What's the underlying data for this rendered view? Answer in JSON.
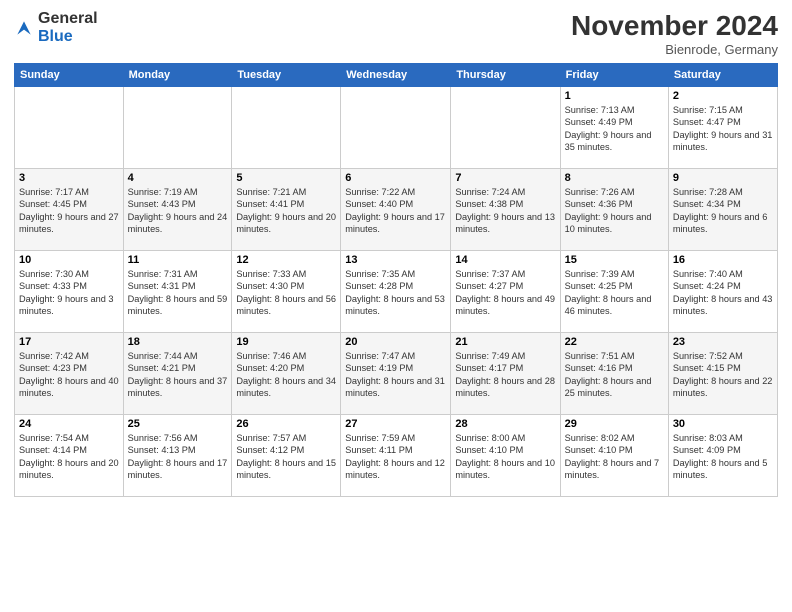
{
  "logo": {
    "general": "General",
    "blue": "Blue"
  },
  "header": {
    "month_year": "November 2024",
    "location": "Bienrode, Germany"
  },
  "days_of_week": [
    "Sunday",
    "Monday",
    "Tuesday",
    "Wednesday",
    "Thursday",
    "Friday",
    "Saturday"
  ],
  "weeks": [
    [
      {
        "day": "",
        "info": ""
      },
      {
        "day": "",
        "info": ""
      },
      {
        "day": "",
        "info": ""
      },
      {
        "day": "",
        "info": ""
      },
      {
        "day": "",
        "info": ""
      },
      {
        "day": "1",
        "info": "Sunrise: 7:13 AM\nSunset: 4:49 PM\nDaylight: 9 hours and 35 minutes."
      },
      {
        "day": "2",
        "info": "Sunrise: 7:15 AM\nSunset: 4:47 PM\nDaylight: 9 hours and 31 minutes."
      }
    ],
    [
      {
        "day": "3",
        "info": "Sunrise: 7:17 AM\nSunset: 4:45 PM\nDaylight: 9 hours and 27 minutes."
      },
      {
        "day": "4",
        "info": "Sunrise: 7:19 AM\nSunset: 4:43 PM\nDaylight: 9 hours and 24 minutes."
      },
      {
        "day": "5",
        "info": "Sunrise: 7:21 AM\nSunset: 4:41 PM\nDaylight: 9 hours and 20 minutes."
      },
      {
        "day": "6",
        "info": "Sunrise: 7:22 AM\nSunset: 4:40 PM\nDaylight: 9 hours and 17 minutes."
      },
      {
        "day": "7",
        "info": "Sunrise: 7:24 AM\nSunset: 4:38 PM\nDaylight: 9 hours and 13 minutes."
      },
      {
        "day": "8",
        "info": "Sunrise: 7:26 AM\nSunset: 4:36 PM\nDaylight: 9 hours and 10 minutes."
      },
      {
        "day": "9",
        "info": "Sunrise: 7:28 AM\nSunset: 4:34 PM\nDaylight: 9 hours and 6 minutes."
      }
    ],
    [
      {
        "day": "10",
        "info": "Sunrise: 7:30 AM\nSunset: 4:33 PM\nDaylight: 9 hours and 3 minutes."
      },
      {
        "day": "11",
        "info": "Sunrise: 7:31 AM\nSunset: 4:31 PM\nDaylight: 8 hours and 59 minutes."
      },
      {
        "day": "12",
        "info": "Sunrise: 7:33 AM\nSunset: 4:30 PM\nDaylight: 8 hours and 56 minutes."
      },
      {
        "day": "13",
        "info": "Sunrise: 7:35 AM\nSunset: 4:28 PM\nDaylight: 8 hours and 53 minutes."
      },
      {
        "day": "14",
        "info": "Sunrise: 7:37 AM\nSunset: 4:27 PM\nDaylight: 8 hours and 49 minutes."
      },
      {
        "day": "15",
        "info": "Sunrise: 7:39 AM\nSunset: 4:25 PM\nDaylight: 8 hours and 46 minutes."
      },
      {
        "day": "16",
        "info": "Sunrise: 7:40 AM\nSunset: 4:24 PM\nDaylight: 8 hours and 43 minutes."
      }
    ],
    [
      {
        "day": "17",
        "info": "Sunrise: 7:42 AM\nSunset: 4:23 PM\nDaylight: 8 hours and 40 minutes."
      },
      {
        "day": "18",
        "info": "Sunrise: 7:44 AM\nSunset: 4:21 PM\nDaylight: 8 hours and 37 minutes."
      },
      {
        "day": "19",
        "info": "Sunrise: 7:46 AM\nSunset: 4:20 PM\nDaylight: 8 hours and 34 minutes."
      },
      {
        "day": "20",
        "info": "Sunrise: 7:47 AM\nSunset: 4:19 PM\nDaylight: 8 hours and 31 minutes."
      },
      {
        "day": "21",
        "info": "Sunrise: 7:49 AM\nSunset: 4:17 PM\nDaylight: 8 hours and 28 minutes."
      },
      {
        "day": "22",
        "info": "Sunrise: 7:51 AM\nSunset: 4:16 PM\nDaylight: 8 hours and 25 minutes."
      },
      {
        "day": "23",
        "info": "Sunrise: 7:52 AM\nSunset: 4:15 PM\nDaylight: 8 hours and 22 minutes."
      }
    ],
    [
      {
        "day": "24",
        "info": "Sunrise: 7:54 AM\nSunset: 4:14 PM\nDaylight: 8 hours and 20 minutes."
      },
      {
        "day": "25",
        "info": "Sunrise: 7:56 AM\nSunset: 4:13 PM\nDaylight: 8 hours and 17 minutes."
      },
      {
        "day": "26",
        "info": "Sunrise: 7:57 AM\nSunset: 4:12 PM\nDaylight: 8 hours and 15 minutes."
      },
      {
        "day": "27",
        "info": "Sunrise: 7:59 AM\nSunset: 4:11 PM\nDaylight: 8 hours and 12 minutes."
      },
      {
        "day": "28",
        "info": "Sunrise: 8:00 AM\nSunset: 4:10 PM\nDaylight: 8 hours and 10 minutes."
      },
      {
        "day": "29",
        "info": "Sunrise: 8:02 AM\nSunset: 4:10 PM\nDaylight: 8 hours and 7 minutes."
      },
      {
        "day": "30",
        "info": "Sunrise: 8:03 AM\nSunset: 4:09 PM\nDaylight: 8 hours and 5 minutes."
      }
    ]
  ]
}
